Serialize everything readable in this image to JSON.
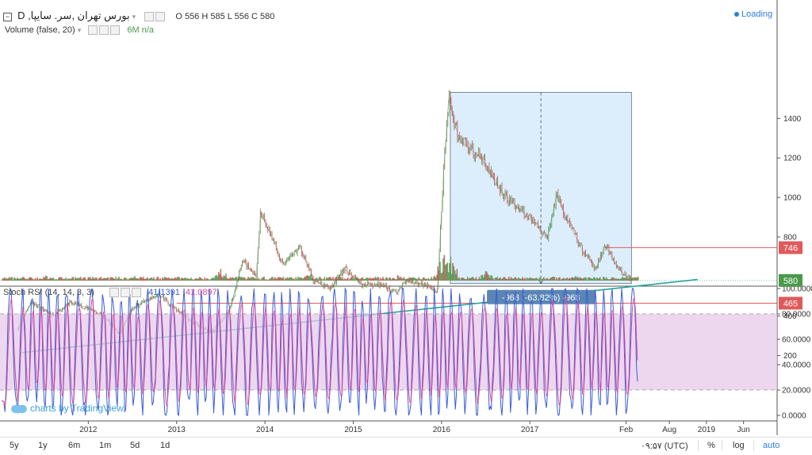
{
  "symbol_line": {
    "title": "بورس تهران ,سر. سايپا, D",
    "ohlc": {
      "o_label": "O",
      "o": "556",
      "h_label": "H",
      "h": "585",
      "l_label": "L",
      "l": "556",
      "c_label": "C",
      "c": "580"
    }
  },
  "volume_line": {
    "label": "Volume (false, 20)",
    "value_label": "6M",
    "value": "n/a"
  },
  "loading_text": "Loading",
  "stoch_line": {
    "label": "Stoch RSI (14, 14, 3, 3)",
    "k": "41.1391",
    "d": "41.0897"
  },
  "measure_label": "-968 (-63.82%) -968",
  "price_tags": {
    "top": "746",
    "current": "580",
    "bottom": "465"
  },
  "watermark": "charts by TradingView",
  "timeframes": [
    "5y",
    "1y",
    "6m",
    "1m",
    "5d",
    "1d"
  ],
  "bottom_right": {
    "time": "۰۹:۵۷ (UTC)",
    "percent": "%",
    "log": "log",
    "auto": "auto"
  },
  "colors": {
    "accent": "#2a7de1",
    "candle_up": "#4a9a4a",
    "candle_down": "#b85450",
    "trendline": "#26a69a",
    "measure_fill": "#dceefc",
    "stoch_k": "#3b5cd6",
    "stoch_d": "#d94aa0",
    "stoch_band": "#e7c9ea",
    "level_line": "#e05a5a"
  },
  "chart_data": [
    {
      "type": "line",
      "title": "",
      "series": [
        {
          "values": [
            [
              2011.2,
              330
            ],
            [
              2011.35,
              470
            ],
            [
              2011.6,
              400
            ],
            [
              2011.8,
              470
            ],
            [
              2012.0,
              440
            ],
            [
              2012.2,
              390
            ],
            [
              2012.35,
              310
            ],
            [
              2012.5,
              440
            ],
            [
              2012.8,
              510
            ],
            [
              2013.0,
              430
            ],
            [
              2013.2,
              360
            ],
            [
              2013.4,
              320
            ],
            [
              2013.6,
              430
            ],
            [
              2013.75,
              680
            ],
            [
              2013.9,
              600
            ],
            [
              2013.95,
              920
            ],
            [
              2014.1,
              780
            ],
            [
              2014.2,
              660
            ],
            [
              2014.4,
              750
            ],
            [
              2014.55,
              580
            ],
            [
              2014.75,
              540
            ],
            [
              2014.9,
              640
            ],
            [
              2015.1,
              560
            ],
            [
              2015.3,
              560
            ],
            [
              2015.5,
              520
            ],
            [
              2015.6,
              580
            ],
            [
              2015.8,
              560
            ],
            [
              2015.95,
              520
            ],
            [
              2016.02,
              1100
            ],
            [
              2016.08,
              1500
            ],
            [
              2016.2,
              1290
            ],
            [
              2016.45,
              1200
            ],
            [
              2016.7,
              1020
            ],
            [
              2017.0,
              890
            ],
            [
              2017.2,
              800
            ],
            [
              2017.3,
              1010
            ],
            [
              2017.45,
              860
            ],
            [
              2017.6,
              730
            ],
            [
              2017.75,
              640
            ],
            [
              2017.85,
              760
            ],
            [
              2018.0,
              640
            ],
            [
              2018.15,
              580
            ]
          ]
        }
      ],
      "x_tick_labels": [
        "2012",
        "2013",
        "2014",
        "2015",
        "2016",
        "2017",
        "Feb",
        "Aug",
        "2019",
        "Jun"
      ],
      "y_tick_labels": [
        "200",
        "400",
        "800",
        "1000",
        "1200",
        "1400"
      ],
      "xlim": [
        2011.0,
        2019.8
      ],
      "ylim": [
        140,
        1540
      ],
      "overlays": {
        "horizontal_levels": [
          746,
          465
        ],
        "current_price": 580,
        "trendline": [
          [
            2011.25,
            215
          ],
          [
            2018.9,
            585
          ]
        ],
        "measure_box": {
          "x": [
            2016.1,
            2018.15
          ],
          "y": [
            564,
            1532
          ],
          "change": "-968 (-63.82%) -968"
        }
      }
    },
    {
      "type": "bar",
      "title": "",
      "series": [
        {
          "values": [
            [
              2011.5,
              0.4
            ],
            [
              2012.5,
              0.4
            ],
            [
              2013.5,
              0.8
            ],
            [
              2014.5,
              0.5
            ],
            [
              2015.5,
              0.4
            ],
            [
              2016.02,
              2.4
            ],
            [
              2016.1,
              1.8
            ],
            [
              2016.5,
              0.7
            ],
            [
              2017.5,
              0.5
            ]
          ]
        }
      ],
      "ylim": [
        0,
        3
      ]
    },
    {
      "type": "line",
      "title": "",
      "series": [
        {
          "values": [
            [
              2011.2,
              90
            ],
            [
              2011.5,
              10
            ],
            [
              2012.0,
              90
            ],
            [
              2012.5,
              20
            ],
            [
              2013.0,
              90
            ],
            [
              2013.5,
              10
            ],
            [
              2014.0,
              95
            ],
            [
              2014.5,
              10
            ],
            [
              2015.0,
              90
            ],
            [
              2015.5,
              15
            ],
            [
              2016.0,
              95
            ],
            [
              2016.5,
              10
            ],
            [
              2017.0,
              95
            ],
            [
              2017.5,
              10
            ],
            [
              2018.0,
              5
            ],
            [
              2018.2,
              45
            ]
          ]
        }
      ],
      "y_tick_labels": [
        "0.0000",
        "20.0000",
        "40.0000",
        "60.0000",
        "80.0000",
        "100.0000"
      ],
      "ylim": [
        0,
        100
      ],
      "bands": [
        20,
        80
      ]
    }
  ]
}
